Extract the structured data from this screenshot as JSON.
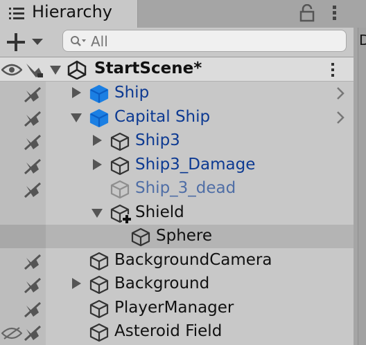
{
  "tab": {
    "title": "Hierarchy",
    "icon": "list-icon"
  },
  "toolbar": {
    "add_label": "+",
    "search_placeholder": "All"
  },
  "scene": {
    "name": "StartScene*"
  },
  "right_panel_letter": "D",
  "rows": [
    {
      "label": "Ship",
      "style": "prefab",
      "icon": "prefab-cube-icon",
      "fold": "collapsed",
      "has_chevron": true
    },
    {
      "label": "Capital Ship",
      "style": "prefab",
      "icon": "prefab-cube-icon",
      "fold": "expanded",
      "has_chevron": true
    },
    {
      "label": "Ship3",
      "style": "prefab",
      "icon": "gameobject-cube-icon",
      "fold": "collapsed"
    },
    {
      "label": "Ship3_Damage",
      "style": "prefab",
      "icon": "gameobject-cube-icon",
      "fold": "collapsed"
    },
    {
      "label": "Ship_3_dead",
      "style": "disabled",
      "icon": "gameobject-cube-icon",
      "fold": "none"
    },
    {
      "label": "Shield",
      "style": "normal",
      "icon": "gameobject-added-icon",
      "fold": "expanded"
    },
    {
      "label": "Sphere",
      "style": "normal",
      "icon": "gameobject-cube-icon",
      "fold": "none",
      "selected": true
    },
    {
      "label": "BackgroundCamera",
      "style": "normal",
      "icon": "gameobject-cube-icon",
      "fold": "none"
    },
    {
      "label": "Background",
      "style": "normal",
      "icon": "gameobject-cube-icon",
      "fold": "collapsed"
    },
    {
      "label": "PlayerManager",
      "style": "normal",
      "icon": "gameobject-cube-icon",
      "fold": "none"
    },
    {
      "label": "Asteroid Field",
      "style": "normal",
      "icon": "gameobject-cube-icon",
      "fold": "none"
    }
  ]
}
